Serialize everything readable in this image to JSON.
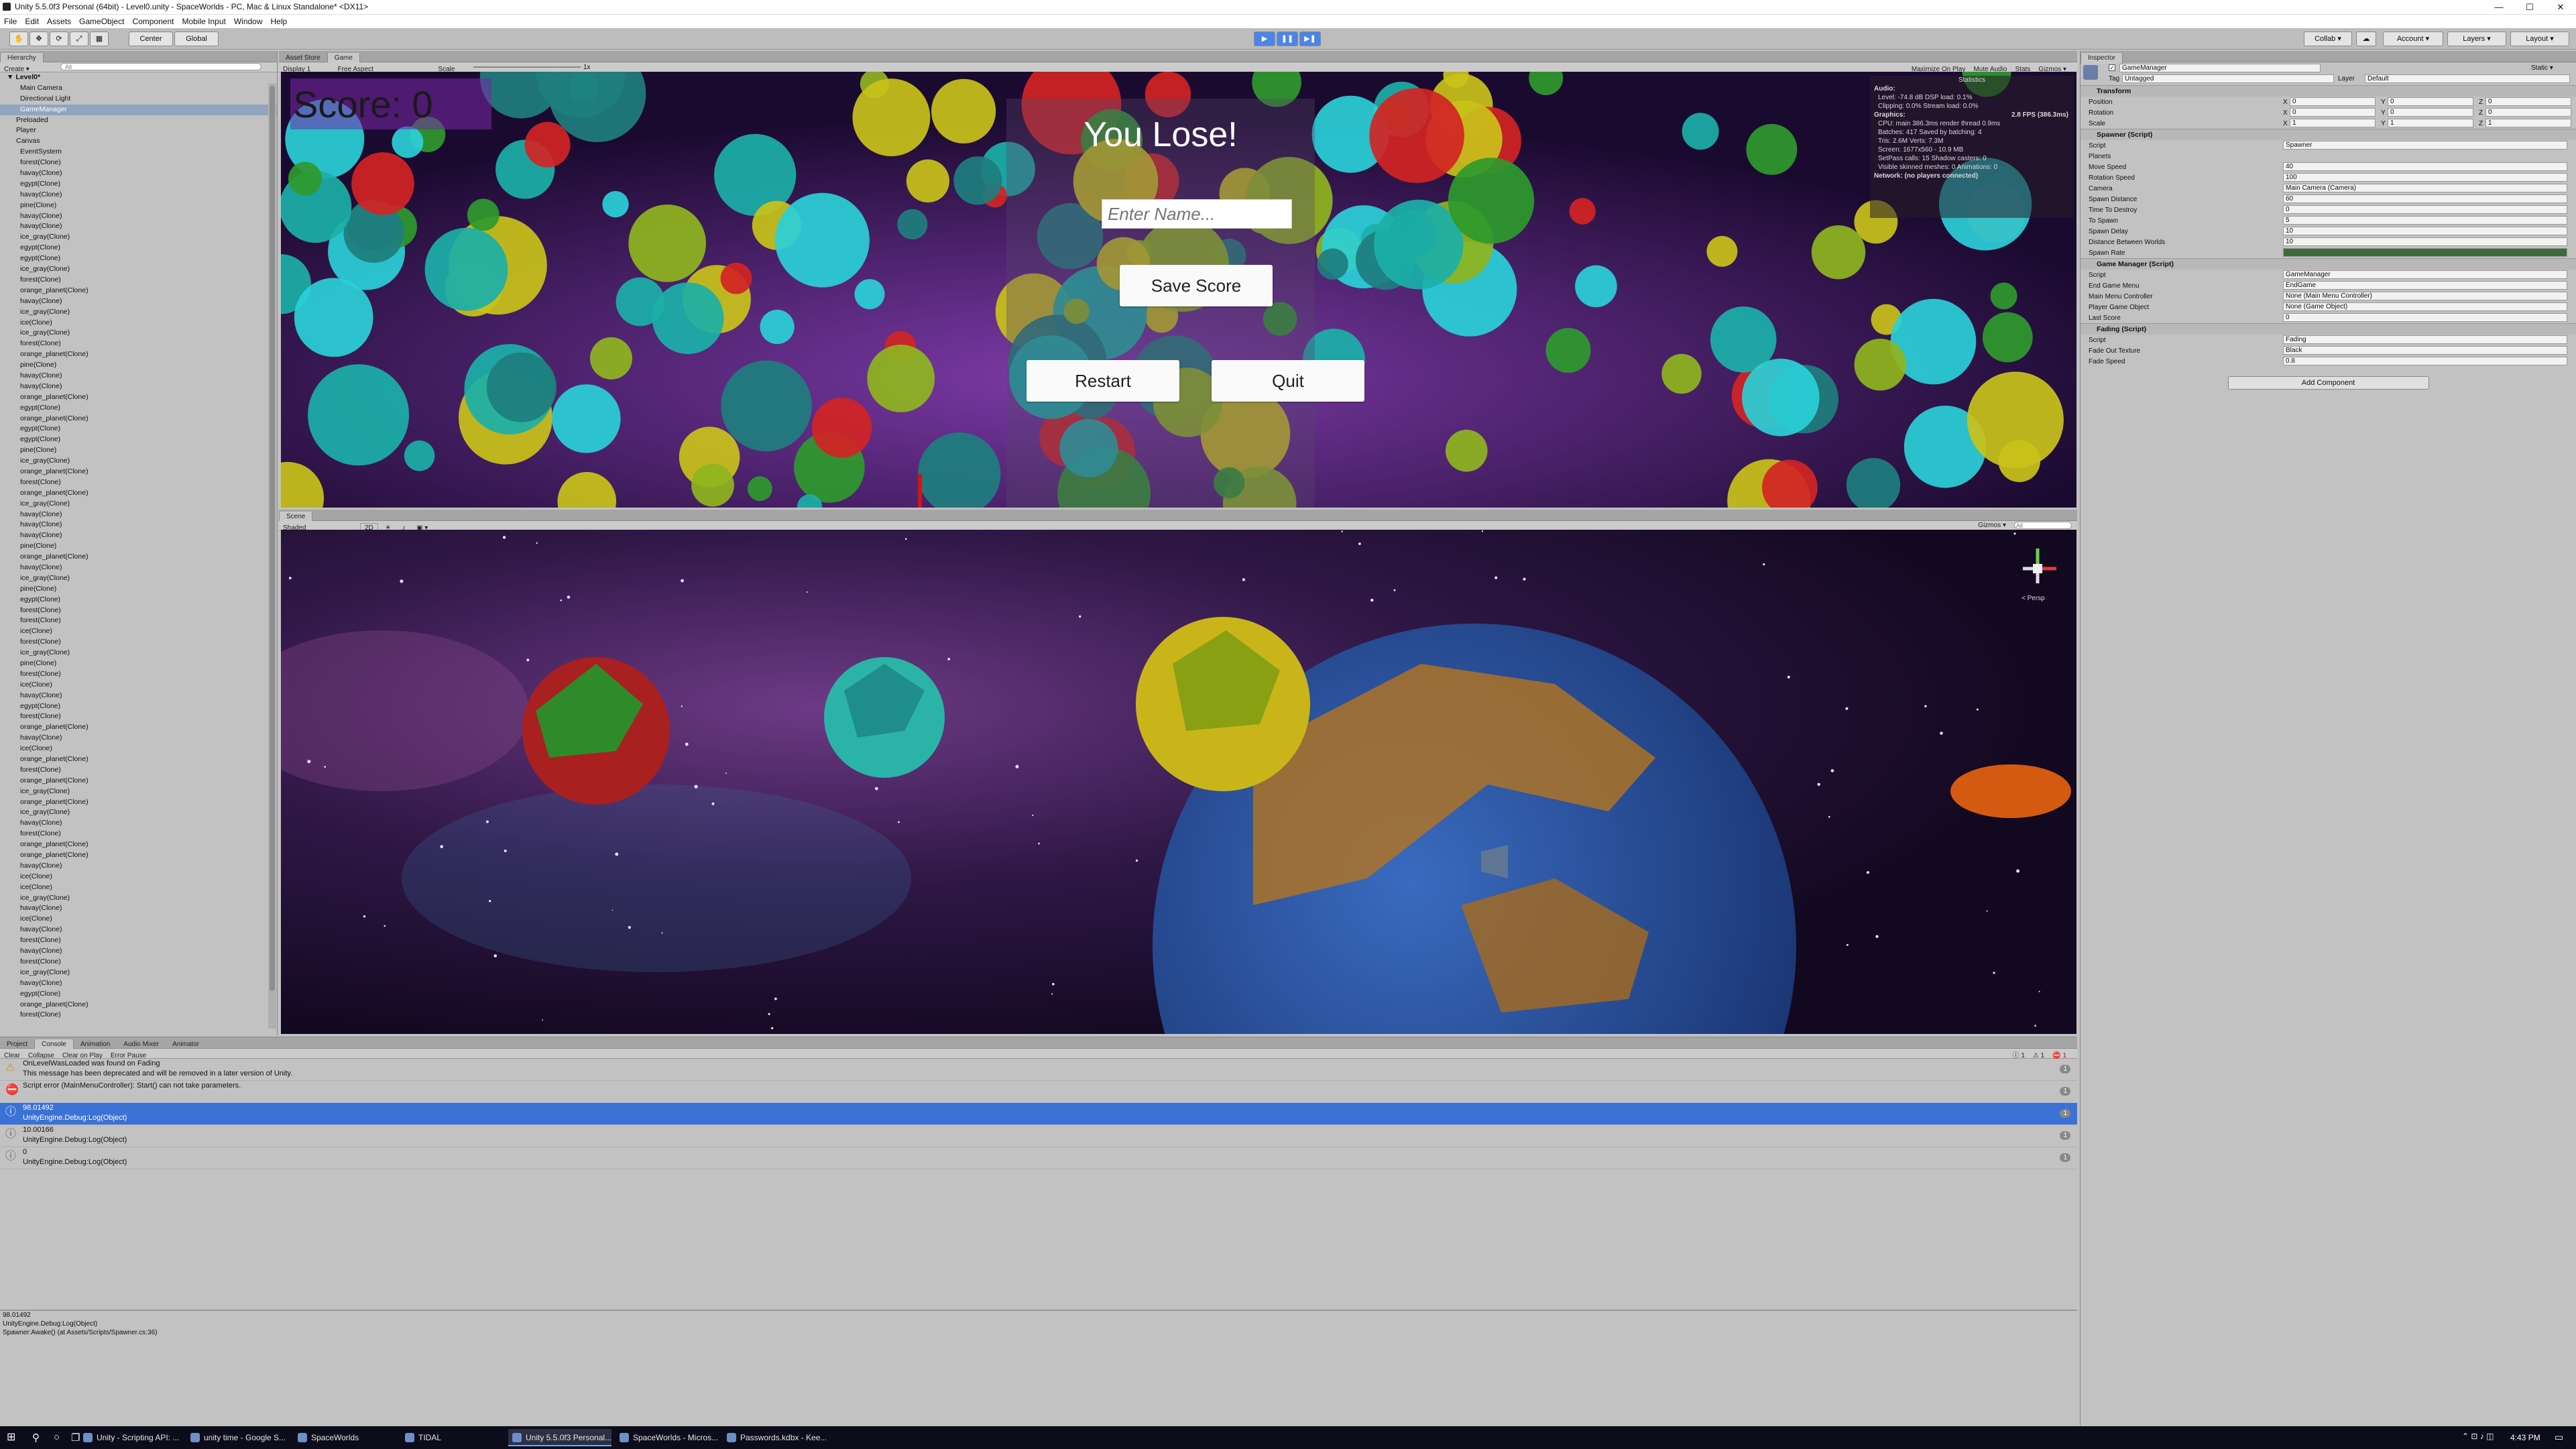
{
  "window": {
    "title": "Unity 5.5.0f3 Personal (64bit) - Level0.unity - SpaceWorlds - PC, Mac & Linux Standalone* <DX11>",
    "minimize": "—",
    "maximize": "☐",
    "close": "✕"
  },
  "menubar": [
    "File",
    "Edit",
    "Assets",
    "GameObject",
    "Component",
    "Mobile Input",
    "Window",
    "Help"
  ],
  "toolbar": {
    "pivot": "Center",
    "space": "Global",
    "collab": "Collab ▾",
    "account": "Account ▾",
    "layers": "Layers ▾",
    "layout": "Layout ▾"
  },
  "hierarchy": {
    "tab": "Hierarchy",
    "create": "Create ▾",
    "search_placeholder": "All",
    "scene": "Level0*",
    "items": [
      "Main Camera",
      "Directional Light",
      "GameManager",
      "Preloaded",
      "Player",
      "Canvas",
      "EventSystem",
      "forest(Clone)",
      "havay(Clone)",
      "egypt(Clone)",
      "havay(Clone)",
      "pine(Clone)",
      "havay(Clone)",
      "havay(Clone)",
      "ice_gray(Clone)",
      "egypt(Clone)",
      "egypt(Clone)",
      "ice_gray(Clone)",
      "forest(Clone)",
      "orange_planet(Clone)",
      "havay(Clone)",
      "ice_gray(Clone)",
      "ice(Clone)",
      "ice_gray(Clone)",
      "forest(Clone)",
      "orange_planet(Clone)",
      "pine(Clone)",
      "havay(Clone)",
      "havay(Clone)",
      "orange_planet(Clone)",
      "egypt(Clone)",
      "orange_planet(Clone)",
      "egypt(Clone)",
      "egypt(Clone)",
      "pine(Clone)",
      "ice_gray(Clone)",
      "orange_planet(Clone)",
      "forest(Clone)",
      "orange_planet(Clone)",
      "ice_gray(Clone)",
      "havay(Clone)",
      "havay(Clone)",
      "havay(Clone)",
      "pine(Clone)",
      "orange_planet(Clone)",
      "havay(Clone)",
      "ice_gray(Clone)",
      "pine(Clone)",
      "egypt(Clone)",
      "forest(Clone)",
      "forest(Clone)",
      "ice(Clone)",
      "forest(Clone)",
      "ice_gray(Clone)",
      "pine(Clone)",
      "forest(Clone)",
      "ice(Clone)",
      "havay(Clone)",
      "egypt(Clone)",
      "forest(Clone)",
      "orange_planet(Clone)",
      "havay(Clone)",
      "ice(Clone)",
      "orange_planet(Clone)",
      "forest(Clone)",
      "orange_planet(Clone)",
      "ice_gray(Clone)",
      "orange_planet(Clone)",
      "ice_gray(Clone)",
      "havay(Clone)",
      "forest(Clone)",
      "orange_planet(Clone)",
      "orange_planet(Clone)",
      "havay(Clone)",
      "ice(Clone)",
      "ice(Clone)",
      "ice_gray(Clone)",
      "havay(Clone)",
      "ice(Clone)",
      "havay(Clone)",
      "forest(Clone)",
      "havay(Clone)",
      "forest(Clone)",
      "ice_gray(Clone)",
      "havay(Clone)",
      "egypt(Clone)",
      "orange_planet(Clone)",
      "forest(Clone)"
    ]
  },
  "game": {
    "tabs": [
      "Asset Store",
      "Game"
    ],
    "display": "Display 1",
    "aspect": "Free Aspect",
    "scale_label": "Scale",
    "scale_value": "1x",
    "right_options": [
      "Maximize On Play",
      "Mute Audio",
      "Stats",
      "Gizmos ▾"
    ],
    "score": "Score: 0",
    "heading": "You Lose!",
    "name_placeholder": "Enter Name...",
    "save_button": "Save Score",
    "restart_button": "Restart",
    "quit_button": "Quit",
    "stats": {
      "title": "Statistics",
      "audio_header": "Audio:",
      "audio_lines": [
        "Level: -74.8 dB   DSP load: 0.1%",
        "Clipping: 0.0%   Stream load: 0.0%"
      ],
      "graphics_header": "Graphics:",
      "fps": "2.8 FPS (386.3ms)",
      "graphics_lines": [
        "CPU: main 386.3ms  render thread 0.9ms",
        "Batches: 417   Saved by batching: 4",
        "Tris: 2.6M   Verts: 7.3M",
        "Screen: 1677x560 - 10.9 MB",
        "SetPass calls: 15   Shadow casters: 0",
        "Visible skinned meshes: 0   Animations: 0"
      ],
      "network": "Network: (no players connected)"
    }
  },
  "scene": {
    "tab": "Scene",
    "shading": "Shaded",
    "mode_2d": "2D",
    "gizmos": "Gizmos ▾",
    "search_placeholder": "All",
    "persp": "< Persp"
  },
  "bottom": {
    "tabs": [
      "Project",
      "Console",
      "Animation",
      "Audio Mixer",
      "Animator"
    ],
    "console_buttons": [
      "Clear",
      "Collapse",
      "Clear on Play",
      "Error Pause"
    ],
    "counts": [
      "1",
      "1",
      "1"
    ],
    "entries": [
      {
        "type": "warning",
        "line1": "OnLevelWasLoaded was found on Fading",
        "line2": "This message has been deprecated and will be removed in a later version of Unity.",
        "count": "1"
      },
      {
        "type": "error",
        "line1": "Script error (MainMenuController): Start() can not take parameters.",
        "line2": "",
        "count": "1"
      },
      {
        "type": "info",
        "line1": "98.01492",
        "line2": "UnityEngine.Debug:Log(Object)",
        "count": "1",
        "selected": true
      },
      {
        "type": "info",
        "line1": "10.00166",
        "line2": "UnityEngine.Debug:Log(Object)",
        "count": "1"
      },
      {
        "type": "info",
        "line1": "0",
        "line2": "UnityEngine.Debug:Log(Object)",
        "count": "1"
      }
    ],
    "detail": [
      "98.01492",
      "UnityEngine.Debug:Log(Object)",
      "Spawner:Awake() (at Assets/Scripts/Spawner.cs:36)"
    ]
  },
  "inspector": {
    "tab": "Inspector",
    "object_name": "GameManager",
    "static_label": "Static ▾",
    "tag_label": "Tag",
    "tag_value": "Untagged",
    "layer_label": "Layer",
    "layer_value": "Default",
    "transform": {
      "title": "Transform",
      "rows": [
        {
          "label": "Position",
          "x": "0",
          "y": "0",
          "z": "0"
        },
        {
          "label": "Rotation",
          "x": "0",
          "y": "0",
          "z": "0"
        },
        {
          "label": "Scale",
          "x": "1",
          "y": "1",
          "z": "1"
        }
      ]
    },
    "spawner": {
      "title": "Spawner (Script)",
      "rows": [
        {
          "label": "Script",
          "value": "Spawner"
        },
        {
          "label": "Planets",
          "value": ""
        },
        {
          "label": "Move Speed",
          "value": "40"
        },
        {
          "label": "Rotation Speed",
          "value": "100"
        },
        {
          "label": "Camera",
          "value": "Main Camera (Camera)"
        },
        {
          "label": "Spawn Distance",
          "value": "60"
        },
        {
          "label": "Time To Destroy",
          "value": "0"
        },
        {
          "label": "To Spawn",
          "value": "5"
        },
        {
          "label": "Spawn Delay",
          "value": "10"
        },
        {
          "label": "Distance Between Worlds",
          "value": "10"
        },
        {
          "label": "Spawn Rate",
          "value": ""
        }
      ]
    },
    "game_manager": {
      "title": "Game Manager (Script)",
      "rows": [
        {
          "label": "Script",
          "value": "GameManager"
        },
        {
          "label": "End Game Menu",
          "value": "EndGame"
        },
        {
          "label": "Main Menu Controller",
          "value": "None (Main Menu Controller)"
        },
        {
          "label": "Player Game Object",
          "value": "None (Game Object)"
        },
        {
          "label": "Last Score",
          "value": "0"
        }
      ]
    },
    "fading": {
      "title": "Fading (Script)",
      "rows": [
        {
          "label": "Script",
          "value": "Fading"
        },
        {
          "label": "Fade Out Texture",
          "value": "Black"
        },
        {
          "label": "Fade Speed",
          "value": "0.8"
        }
      ]
    },
    "add_component": "Add Component"
  },
  "taskbar": {
    "items": [
      {
        "label": "Unity - Scripting API: ...",
        "icon": "chrome-icon"
      },
      {
        "label": "unity time - Google S...",
        "icon": "chrome-icon"
      },
      {
        "label": "SpaceWorlds",
        "icon": "folder-icon"
      },
      {
        "label": "TIDAL",
        "icon": "tidal-icon"
      },
      {
        "label": "Unity 5.5.0f3 Personal...",
        "icon": "unity-icon"
      },
      {
        "label": "SpaceWorlds - Micros...",
        "icon": "visual-studio-icon"
      },
      {
        "label": "Passwords.kdbx - Kee...",
        "icon": "keepass-icon"
      }
    ],
    "clock": "4:43 PM"
  },
  "colors": {
    "accent": "#3a72d6",
    "score_text": "#1a1a1a",
    "game_bg": "#2c1040"
  }
}
